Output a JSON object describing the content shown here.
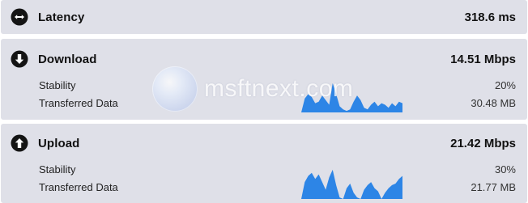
{
  "latency": {
    "label": "Latency",
    "value": "318.6 ms"
  },
  "download": {
    "label": "Download",
    "value": "14.51 Mbps",
    "stability_label": "Stability",
    "stability_value": "20%",
    "transferred_label": "Transferred Data",
    "transferred_value": "30.48 MB",
    "graph": [
      0.0,
      0.45,
      0.6,
      0.5,
      0.3,
      0.35,
      0.55,
      0.4,
      0.25,
      0.95,
      0.6,
      0.2,
      0.1,
      0.05,
      0.1,
      0.35,
      0.55,
      0.4,
      0.15,
      0.1,
      0.25,
      0.35,
      0.2,
      0.3,
      0.25,
      0.15,
      0.3,
      0.2,
      0.35,
      0.3
    ]
  },
  "upload": {
    "label": "Upload",
    "value": "21.42 Mbps",
    "stability_label": "Stability",
    "stability_value": "30%",
    "transferred_label": "Transferred Data",
    "transferred_value": "21.77 MB",
    "graph": [
      0.0,
      0.55,
      0.75,
      0.85,
      0.65,
      0.8,
      0.55,
      0.3,
      0.7,
      0.95,
      0.45,
      0.05,
      0.0,
      0.35,
      0.5,
      0.2,
      0.05,
      0.0,
      0.3,
      0.45,
      0.55,
      0.35,
      0.25,
      0.0,
      0.2,
      0.35,
      0.45,
      0.5,
      0.65,
      0.75
    ]
  },
  "watermark": {
    "text": "msftnext.com"
  },
  "colors": {
    "panel_bg": "#dfe0e8",
    "graph_fill": "#2d85e6"
  }
}
